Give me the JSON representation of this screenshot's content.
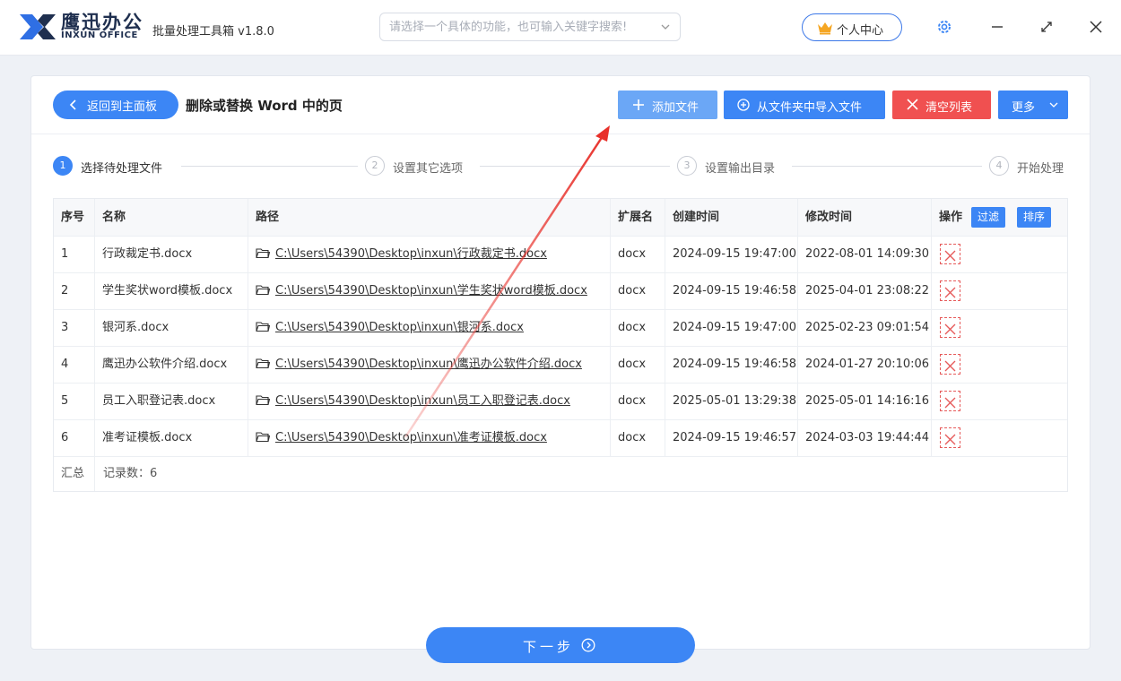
{
  "app": {
    "brand_cn": "鹰迅办公",
    "brand_en": "INXUN OFFICE",
    "title": "批量处理工具箱 v1.8.0",
    "search_placeholder": "请选择一个具体的功能，也可输入关键字搜索!",
    "personal_center": "个人中心"
  },
  "toolbar": {
    "back": "返回到主面板",
    "page_title": "删除或替换 Word 中的页",
    "add_file": "添加文件",
    "import_folder": "从文件夹中导入文件",
    "clear_list": "清空列表",
    "more": "更多"
  },
  "steps": [
    {
      "num": "1",
      "label": "选择待处理文件"
    },
    {
      "num": "2",
      "label": "设置其它选项"
    },
    {
      "num": "3",
      "label": "设置输出目录"
    },
    {
      "num": "4",
      "label": "开始处理"
    }
  ],
  "table": {
    "headers": {
      "idx": "序号",
      "name": "名称",
      "path": "路径",
      "ext": "扩展名",
      "ctime": "创建时间",
      "mtime": "修改时间",
      "ops": "操作",
      "filter": "过滤",
      "sort": "排序"
    },
    "rows": [
      {
        "idx": "1",
        "name": "行政裁定书.docx",
        "path": "C:\\Users\\54390\\Desktop\\inxun\\行政裁定书.docx",
        "ext": "docx",
        "ctime": "2024-09-15 19:47:00",
        "mtime": "2022-08-01 14:09:30"
      },
      {
        "idx": "2",
        "name": "学生奖状word模板.docx",
        "path": "C:\\Users\\54390\\Desktop\\inxun\\学生奖状word模板.docx",
        "ext": "docx",
        "ctime": "2024-09-15 19:46:58",
        "mtime": "2025-04-01 23:08:22"
      },
      {
        "idx": "3",
        "name": "银河系.docx",
        "path": "C:\\Users\\54390\\Desktop\\inxun\\银河系.docx",
        "ext": "docx",
        "ctime": "2024-09-15 19:47:00",
        "mtime": "2025-02-23 09:01:54"
      },
      {
        "idx": "4",
        "name": "鹰迅办公软件介绍.docx",
        "path": "C:\\Users\\54390\\Desktop\\inxun\\鹰迅办公软件介绍.docx",
        "ext": "docx",
        "ctime": "2024-09-15 19:46:58",
        "mtime": "2024-01-27 20:10:06"
      },
      {
        "idx": "5",
        "name": "员工入职登记表.docx",
        "path": "C:\\Users\\54390\\Desktop\\inxun\\员工入职登记表.docx",
        "ext": "docx",
        "ctime": "2025-05-01 13:29:38",
        "mtime": "2025-05-01 14:16:16"
      },
      {
        "idx": "6",
        "name": "准考证模板.docx",
        "path": "C:\\Users\\54390\\Desktop\\inxun\\准考证模板.docx",
        "ext": "docx",
        "ctime": "2024-09-15 19:46:57",
        "mtime": "2024-03-03 19:44:44"
      }
    ],
    "summary_label": "汇总",
    "summary_count": "记录数：6"
  },
  "footer": {
    "next": "下一步"
  },
  "colors": {
    "accent": "#3c86f5",
    "accent_light": "#6ba7f6",
    "danger": "#f05050",
    "annotation_arrow": "#e8302a"
  }
}
